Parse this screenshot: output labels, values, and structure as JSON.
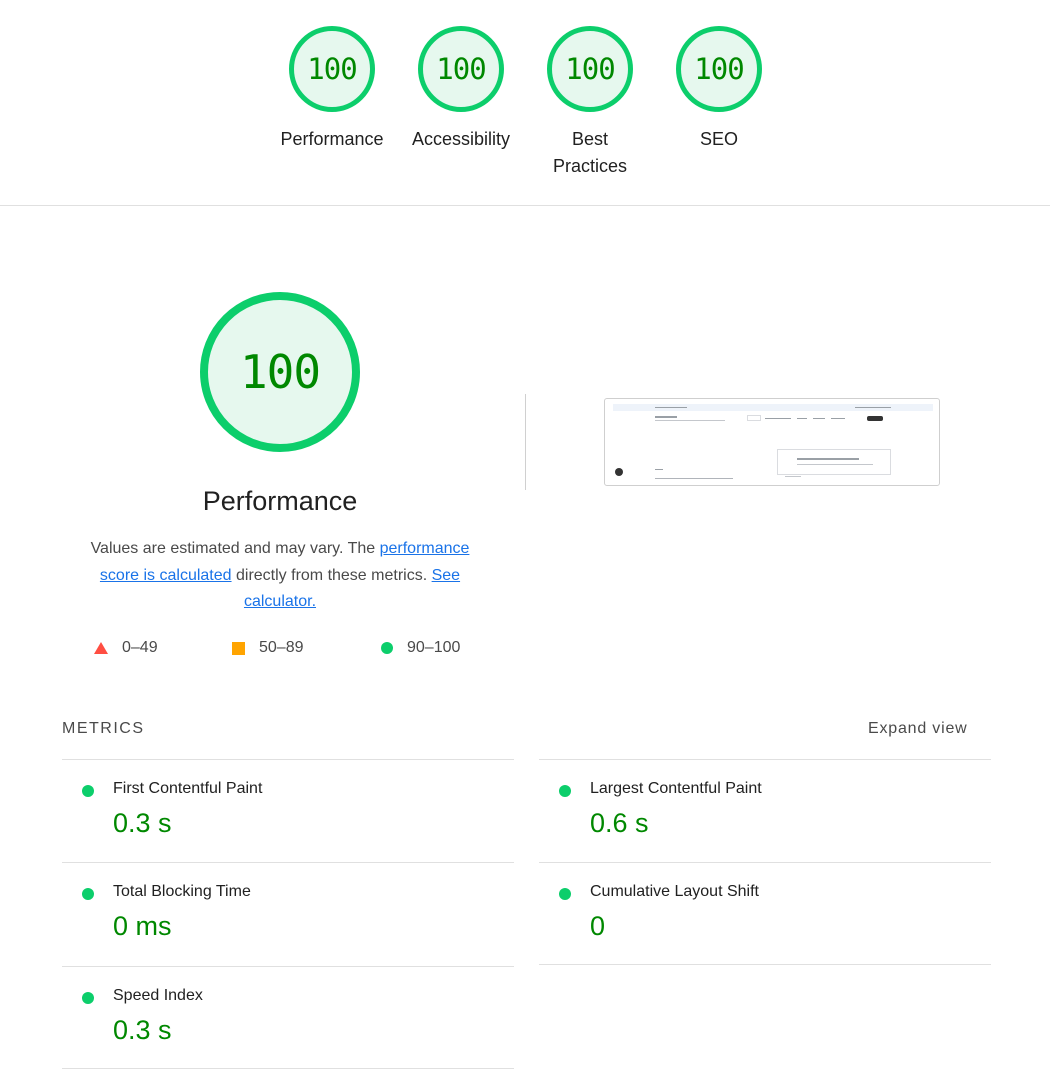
{
  "categories": [
    {
      "score": "100",
      "label": "Performance"
    },
    {
      "score": "100",
      "label": "Accessibility"
    },
    {
      "score": "100",
      "label": "Best Practices"
    },
    {
      "score": "100",
      "label": "SEO"
    }
  ],
  "performance": {
    "score": "100",
    "title": "Performance",
    "desc_text1": "Values are estimated and may vary. The ",
    "desc_link1": "performance score is calculated",
    "desc_text2": " directly from these metrics. ",
    "desc_link2": "See calculator."
  },
  "legend": [
    {
      "range": "0–49",
      "icon": "triangle-icon",
      "color": "#ff4e42"
    },
    {
      "range": "50–89",
      "icon": "square-icon",
      "color": "#ffa400"
    },
    {
      "range": "90–100",
      "icon": "circle-icon",
      "color": "#0cce6b"
    }
  ],
  "metrics": {
    "heading": "METRICS",
    "expand_label": "Expand view",
    "items": [
      {
        "name": "First Contentful Paint",
        "value": "0.3 s"
      },
      {
        "name": "Largest Contentful Paint",
        "value": "0.6 s"
      },
      {
        "name": "Total Blocking Time",
        "value": "0 ms"
      },
      {
        "name": "Cumulative Layout Shift",
        "value": "0"
      },
      {
        "name": "Speed Index",
        "value": "0.3 s"
      }
    ]
  },
  "colors": {
    "pass": "#0cce6b",
    "pass_text": "#008800",
    "link": "#1a73e8"
  }
}
